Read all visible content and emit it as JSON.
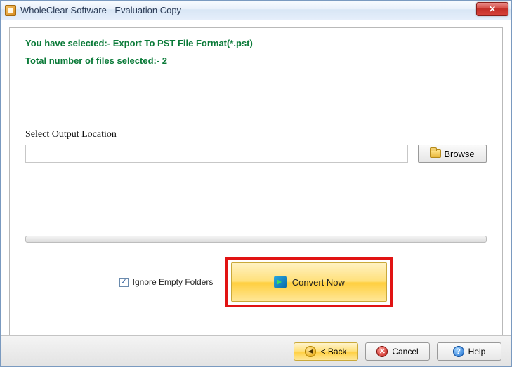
{
  "window": {
    "title": "WholeClear Software - Evaluation Copy"
  },
  "info": {
    "line1": "You have selected:- Export To PST File Format(*.pst)",
    "line2": "Total number of files selected:- 2"
  },
  "output": {
    "label": "Select Output Location",
    "value": "",
    "browse_label": "Browse"
  },
  "options": {
    "ignore_empty_label": "Ignore Empty Folders",
    "ignore_empty_checked": true
  },
  "actions": {
    "convert_label": "Convert Now"
  },
  "footer": {
    "back_label": "< Back",
    "cancel_label": "Cancel",
    "help_label": "Help"
  }
}
